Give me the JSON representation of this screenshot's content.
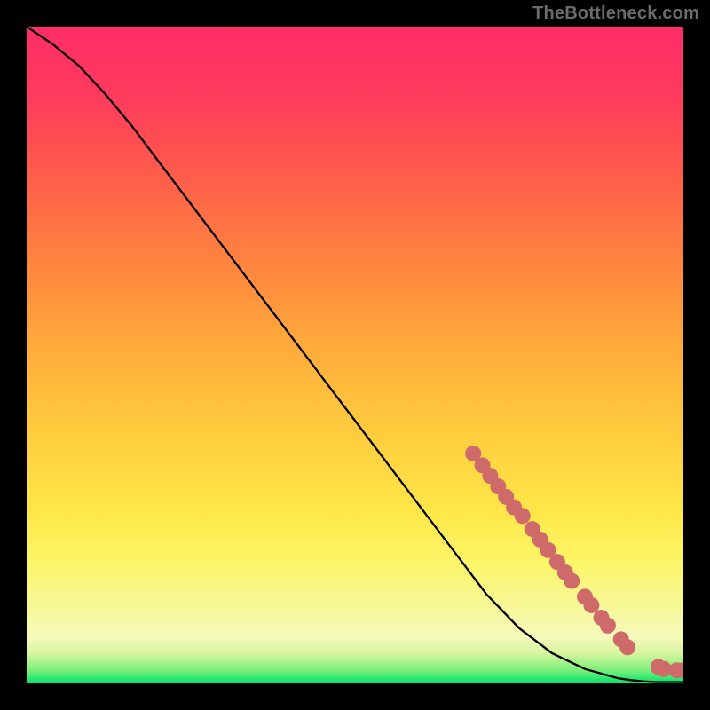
{
  "attribution": "TheBottleneck.com",
  "chart_data": {
    "type": "line",
    "title": "",
    "xlabel": "",
    "ylabel": "",
    "xlim": [
      0,
      100
    ],
    "ylim": [
      0,
      100
    ],
    "series": [
      {
        "name": "curve",
        "x": [
          0,
          4,
          8,
          12,
          16,
          20,
          25,
          30,
          35,
          40,
          45,
          50,
          55,
          60,
          65,
          70,
          75,
          80,
          85,
          90,
          92,
          94,
          96,
          98,
          100
        ],
        "y": [
          100,
          97.3,
          94.0,
          89.7,
          84.9,
          79.6,
          73.0,
          66.4,
          59.8,
          53.2,
          46.6,
          40.0,
          33.4,
          26.8,
          20.2,
          13.6,
          8.4,
          4.6,
          2.2,
          0.8,
          0.5,
          0.3,
          0.2,
          0.2,
          0.2
        ]
      }
    ],
    "markers": [
      {
        "x": 68.0,
        "y": 35.0
      },
      {
        "x": 69.4,
        "y": 33.2
      },
      {
        "x": 70.6,
        "y": 31.6
      },
      {
        "x": 71.8,
        "y": 30.0
      },
      {
        "x": 73.0,
        "y": 28.4
      },
      {
        "x": 74.2,
        "y": 26.8
      },
      {
        "x": 75.5,
        "y": 25.5
      },
      {
        "x": 77.0,
        "y": 23.5
      },
      {
        "x": 78.2,
        "y": 21.9
      },
      {
        "x": 79.4,
        "y": 20.3
      },
      {
        "x": 80.8,
        "y": 18.5
      },
      {
        "x": 82.0,
        "y": 16.9
      },
      {
        "x": 83.0,
        "y": 15.6
      },
      {
        "x": 85.0,
        "y": 13.2
      },
      {
        "x": 86.0,
        "y": 11.9
      },
      {
        "x": 87.5,
        "y": 10.0
      },
      {
        "x": 88.5,
        "y": 8.8
      },
      {
        "x": 90.5,
        "y": 6.7
      },
      {
        "x": 91.5,
        "y": 5.5
      },
      {
        "x": 96.2,
        "y": 2.5
      },
      {
        "x": 97.0,
        "y": 2.2
      },
      {
        "x": 99.0,
        "y": 2.0
      },
      {
        "x": 100.0,
        "y": 2.0
      }
    ],
    "marker_style": {
      "color": "#cf6a6a",
      "radius_px": 9
    },
    "background_gradient": {
      "direction": "vertical",
      "stops": [
        {
          "pos": 0.0,
          "color": "#ff2d66"
        },
        {
          "pos": 0.5,
          "color": "#ffc83d"
        },
        {
          "pos": 0.8,
          "color": "#fbf66a"
        },
        {
          "pos": 0.95,
          "color": "#d5f59d"
        },
        {
          "pos": 1.0,
          "color": "#00e36c"
        }
      ]
    }
  }
}
